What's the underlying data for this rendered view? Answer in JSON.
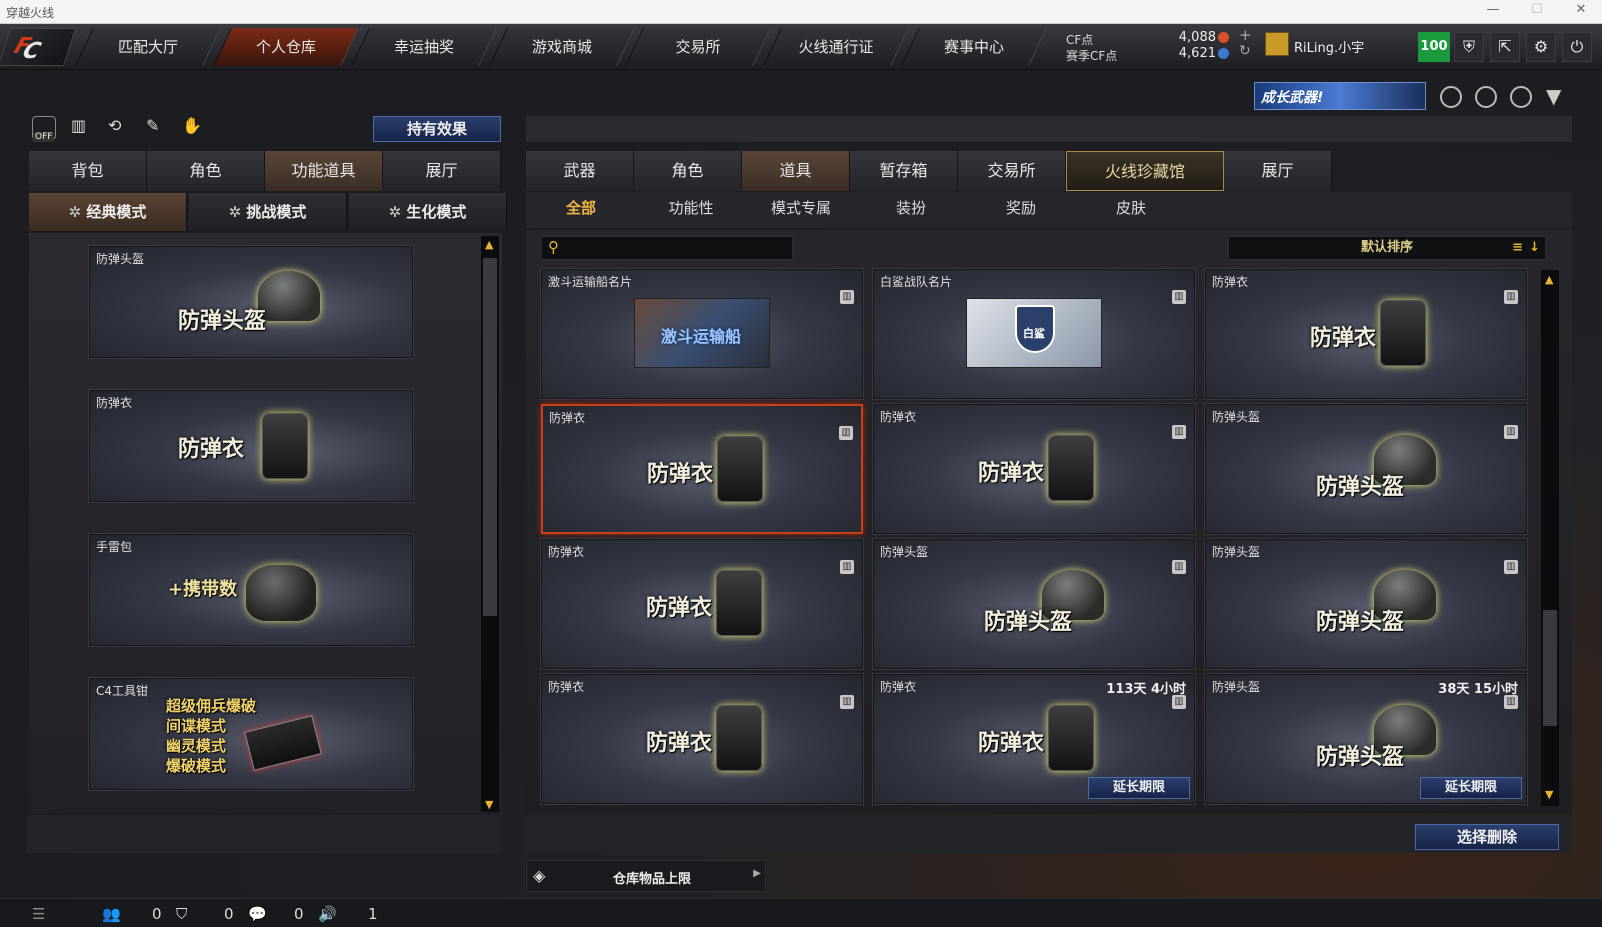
{
  "window": {
    "title": "穿越火线",
    "min": "—",
    "max": "☐",
    "close": "✕"
  },
  "nav": {
    "logo_main": "C",
    "logo_accent": "F",
    "tabs": [
      "匹配大厅",
      "个人仓库",
      "幸运抽奖",
      "游戏商城",
      "交易所",
      "火线通行证",
      "赛事中心"
    ],
    "active": 1
  },
  "currency": {
    "cf_label": "CF点",
    "cf_value": "4,088",
    "season_label": "赛季CF点",
    "season_value": "4,621",
    "plus": "+",
    "refresh": "↻"
  },
  "user": {
    "name": "RiLing.小宇",
    "level": "100"
  },
  "top_icons": {
    "shield": "⛨",
    "exit": "⇱",
    "settings": "⚙",
    "power": "⏻"
  },
  "banner": {
    "text": "成长武器!"
  },
  "left": {
    "effects_btn": "持有效果",
    "off_label": "OFF",
    "tabs": [
      "背包",
      "角色",
      "功能道具",
      "展厅"
    ],
    "active_tab": 2,
    "modes": [
      "经典模式",
      "挑战模式",
      "生化模式"
    ],
    "active_mode": 0,
    "items": [
      {
        "label": "防弹头盔",
        "big": "防弹头盔"
      },
      {
        "label": "防弹衣",
        "big": "防弹衣"
      },
      {
        "label": "手雷包",
        "big": "+携带数"
      },
      {
        "label": "C4工具钳",
        "lines": [
          "超级佣兵爆破",
          "间谍模式",
          "幽灵模式",
          "爆破模式"
        ]
      }
    ]
  },
  "right": {
    "tabs": [
      "武器",
      "角色",
      "道具",
      "暂存箱",
      "交易所",
      "火线珍藏馆",
      "展厅"
    ],
    "active_tab": 2,
    "gold_tab": 5,
    "subtabs": [
      "全部",
      "功能性",
      "模式专属",
      "装扮",
      "奖励",
      "皮肤"
    ],
    "active_sub": 0,
    "search_placeholder": "",
    "sort_label": "默认排序",
    "items": [
      {
        "label": "激斗运输船名片",
        "type": "card",
        "card_text": "激斗运输船"
      },
      {
        "label": "白鲨战队名片",
        "type": "card2",
        "card_text": "白鲨"
      },
      {
        "label": "防弹衣",
        "type": "vest",
        "big": "防弹衣"
      },
      {
        "label": "防弹衣",
        "type": "vest",
        "big": "防弹衣",
        "selected": true
      },
      {
        "label": "防弹衣",
        "type": "vest",
        "big": "防弹衣"
      },
      {
        "label": "防弹头盔",
        "type": "helmet",
        "big": "防弹头盔"
      },
      {
        "label": "防弹衣",
        "type": "vest",
        "big": "防弹衣"
      },
      {
        "label": "防弹头盔",
        "type": "helmet",
        "big": "防弹头盔"
      },
      {
        "label": "防弹头盔",
        "type": "helmet",
        "big": "防弹头盔"
      },
      {
        "label": "防弹衣",
        "type": "vest",
        "big": "防弹衣"
      },
      {
        "label": "防弹衣",
        "type": "vest",
        "big": "防弹衣",
        "timer": "113天 4小时",
        "extend": "延长期限"
      },
      {
        "label": "防弹头盔",
        "type": "helmet",
        "big": "防弹头盔",
        "timer": "38天 15小时",
        "extend": "延长期限"
      }
    ],
    "delete_btn": "选择删除",
    "capacity_label": "仓库物品上限"
  },
  "bottom": {
    "v1": "0",
    "v2": "0",
    "v3": "0",
    "v4": "1"
  }
}
